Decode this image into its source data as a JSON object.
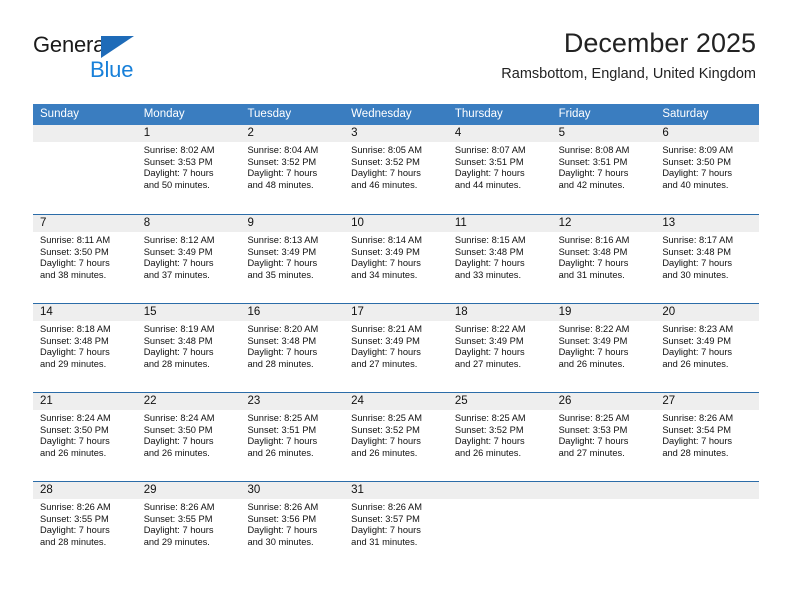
{
  "logo": {
    "word_one": "General",
    "word_two": "Blue",
    "accent_color": "#1880d9",
    "triangle_color": "#1e6bb8"
  },
  "header": {
    "title": "December 2025",
    "subtitle": "Ramsbottom, England, United Kingdom"
  },
  "theme": {
    "header_row_bg": "#3a7dc0",
    "row_divider": "#2b6ca8",
    "day_band_bg": "#eeeeee",
    "text": "#111111"
  },
  "weekdays": [
    "Sunday",
    "Monday",
    "Tuesday",
    "Wednesday",
    "Thursday",
    "Friday",
    "Saturday"
  ],
  "weeks": [
    [
      {
        "day": "",
        "sunrise": "",
        "sunset": "",
        "daylight_line1": "",
        "daylight_line2": ""
      },
      {
        "day": "1",
        "sunrise": "Sunrise: 8:02 AM",
        "sunset": "Sunset: 3:53 PM",
        "daylight_line1": "Daylight: 7 hours",
        "daylight_line2": "and 50 minutes."
      },
      {
        "day": "2",
        "sunrise": "Sunrise: 8:04 AM",
        "sunset": "Sunset: 3:52 PM",
        "daylight_line1": "Daylight: 7 hours",
        "daylight_line2": "and 48 minutes."
      },
      {
        "day": "3",
        "sunrise": "Sunrise: 8:05 AM",
        "sunset": "Sunset: 3:52 PM",
        "daylight_line1": "Daylight: 7 hours",
        "daylight_line2": "and 46 minutes."
      },
      {
        "day": "4",
        "sunrise": "Sunrise: 8:07 AM",
        "sunset": "Sunset: 3:51 PM",
        "daylight_line1": "Daylight: 7 hours",
        "daylight_line2": "and 44 minutes."
      },
      {
        "day": "5",
        "sunrise": "Sunrise: 8:08 AM",
        "sunset": "Sunset: 3:51 PM",
        "daylight_line1": "Daylight: 7 hours",
        "daylight_line2": "and 42 minutes."
      },
      {
        "day": "6",
        "sunrise": "Sunrise: 8:09 AM",
        "sunset": "Sunset: 3:50 PM",
        "daylight_line1": "Daylight: 7 hours",
        "daylight_line2": "and 40 minutes."
      }
    ],
    [
      {
        "day": "7",
        "sunrise": "Sunrise: 8:11 AM",
        "sunset": "Sunset: 3:50 PM",
        "daylight_line1": "Daylight: 7 hours",
        "daylight_line2": "and 38 minutes."
      },
      {
        "day": "8",
        "sunrise": "Sunrise: 8:12 AM",
        "sunset": "Sunset: 3:49 PM",
        "daylight_line1": "Daylight: 7 hours",
        "daylight_line2": "and 37 minutes."
      },
      {
        "day": "9",
        "sunrise": "Sunrise: 8:13 AM",
        "sunset": "Sunset: 3:49 PM",
        "daylight_line1": "Daylight: 7 hours",
        "daylight_line2": "and 35 minutes."
      },
      {
        "day": "10",
        "sunrise": "Sunrise: 8:14 AM",
        "sunset": "Sunset: 3:49 PM",
        "daylight_line1": "Daylight: 7 hours",
        "daylight_line2": "and 34 minutes."
      },
      {
        "day": "11",
        "sunrise": "Sunrise: 8:15 AM",
        "sunset": "Sunset: 3:48 PM",
        "daylight_line1": "Daylight: 7 hours",
        "daylight_line2": "and 33 minutes."
      },
      {
        "day": "12",
        "sunrise": "Sunrise: 8:16 AM",
        "sunset": "Sunset: 3:48 PM",
        "daylight_line1": "Daylight: 7 hours",
        "daylight_line2": "and 31 minutes."
      },
      {
        "day": "13",
        "sunrise": "Sunrise: 8:17 AM",
        "sunset": "Sunset: 3:48 PM",
        "daylight_line1": "Daylight: 7 hours",
        "daylight_line2": "and 30 minutes."
      }
    ],
    [
      {
        "day": "14",
        "sunrise": "Sunrise: 8:18 AM",
        "sunset": "Sunset: 3:48 PM",
        "daylight_line1": "Daylight: 7 hours",
        "daylight_line2": "and 29 minutes."
      },
      {
        "day": "15",
        "sunrise": "Sunrise: 8:19 AM",
        "sunset": "Sunset: 3:48 PM",
        "daylight_line1": "Daylight: 7 hours",
        "daylight_line2": "and 28 minutes."
      },
      {
        "day": "16",
        "sunrise": "Sunrise: 8:20 AM",
        "sunset": "Sunset: 3:48 PM",
        "daylight_line1": "Daylight: 7 hours",
        "daylight_line2": "and 28 minutes."
      },
      {
        "day": "17",
        "sunrise": "Sunrise: 8:21 AM",
        "sunset": "Sunset: 3:49 PM",
        "daylight_line1": "Daylight: 7 hours",
        "daylight_line2": "and 27 minutes."
      },
      {
        "day": "18",
        "sunrise": "Sunrise: 8:22 AM",
        "sunset": "Sunset: 3:49 PM",
        "daylight_line1": "Daylight: 7 hours",
        "daylight_line2": "and 27 minutes."
      },
      {
        "day": "19",
        "sunrise": "Sunrise: 8:22 AM",
        "sunset": "Sunset: 3:49 PM",
        "daylight_line1": "Daylight: 7 hours",
        "daylight_line2": "and 26 minutes."
      },
      {
        "day": "20",
        "sunrise": "Sunrise: 8:23 AM",
        "sunset": "Sunset: 3:49 PM",
        "daylight_line1": "Daylight: 7 hours",
        "daylight_line2": "and 26 minutes."
      }
    ],
    [
      {
        "day": "21",
        "sunrise": "Sunrise: 8:24 AM",
        "sunset": "Sunset: 3:50 PM",
        "daylight_line1": "Daylight: 7 hours",
        "daylight_line2": "and 26 minutes."
      },
      {
        "day": "22",
        "sunrise": "Sunrise: 8:24 AM",
        "sunset": "Sunset: 3:50 PM",
        "daylight_line1": "Daylight: 7 hours",
        "daylight_line2": "and 26 minutes."
      },
      {
        "day": "23",
        "sunrise": "Sunrise: 8:25 AM",
        "sunset": "Sunset: 3:51 PM",
        "daylight_line1": "Daylight: 7 hours",
        "daylight_line2": "and 26 minutes."
      },
      {
        "day": "24",
        "sunrise": "Sunrise: 8:25 AM",
        "sunset": "Sunset: 3:52 PM",
        "daylight_line1": "Daylight: 7 hours",
        "daylight_line2": "and 26 minutes."
      },
      {
        "day": "25",
        "sunrise": "Sunrise: 8:25 AM",
        "sunset": "Sunset: 3:52 PM",
        "daylight_line1": "Daylight: 7 hours",
        "daylight_line2": "and 26 minutes."
      },
      {
        "day": "26",
        "sunrise": "Sunrise: 8:25 AM",
        "sunset": "Sunset: 3:53 PM",
        "daylight_line1": "Daylight: 7 hours",
        "daylight_line2": "and 27 minutes."
      },
      {
        "day": "27",
        "sunrise": "Sunrise: 8:26 AM",
        "sunset": "Sunset: 3:54 PM",
        "daylight_line1": "Daylight: 7 hours",
        "daylight_line2": "and 28 minutes."
      }
    ],
    [
      {
        "day": "28",
        "sunrise": "Sunrise: 8:26 AM",
        "sunset": "Sunset: 3:55 PM",
        "daylight_line1": "Daylight: 7 hours",
        "daylight_line2": "and 28 minutes."
      },
      {
        "day": "29",
        "sunrise": "Sunrise: 8:26 AM",
        "sunset": "Sunset: 3:55 PM",
        "daylight_line1": "Daylight: 7 hours",
        "daylight_line2": "and 29 minutes."
      },
      {
        "day": "30",
        "sunrise": "Sunrise: 8:26 AM",
        "sunset": "Sunset: 3:56 PM",
        "daylight_line1": "Daylight: 7 hours",
        "daylight_line2": "and 30 minutes."
      },
      {
        "day": "31",
        "sunrise": "Sunrise: 8:26 AM",
        "sunset": "Sunset: 3:57 PM",
        "daylight_line1": "Daylight: 7 hours",
        "daylight_line2": "and 31 minutes."
      },
      {
        "day": "",
        "sunrise": "",
        "sunset": "",
        "daylight_line1": "",
        "daylight_line2": ""
      },
      {
        "day": "",
        "sunrise": "",
        "sunset": "",
        "daylight_line1": "",
        "daylight_line2": ""
      },
      {
        "day": "",
        "sunrise": "",
        "sunset": "",
        "daylight_line1": "",
        "daylight_line2": ""
      }
    ]
  ]
}
